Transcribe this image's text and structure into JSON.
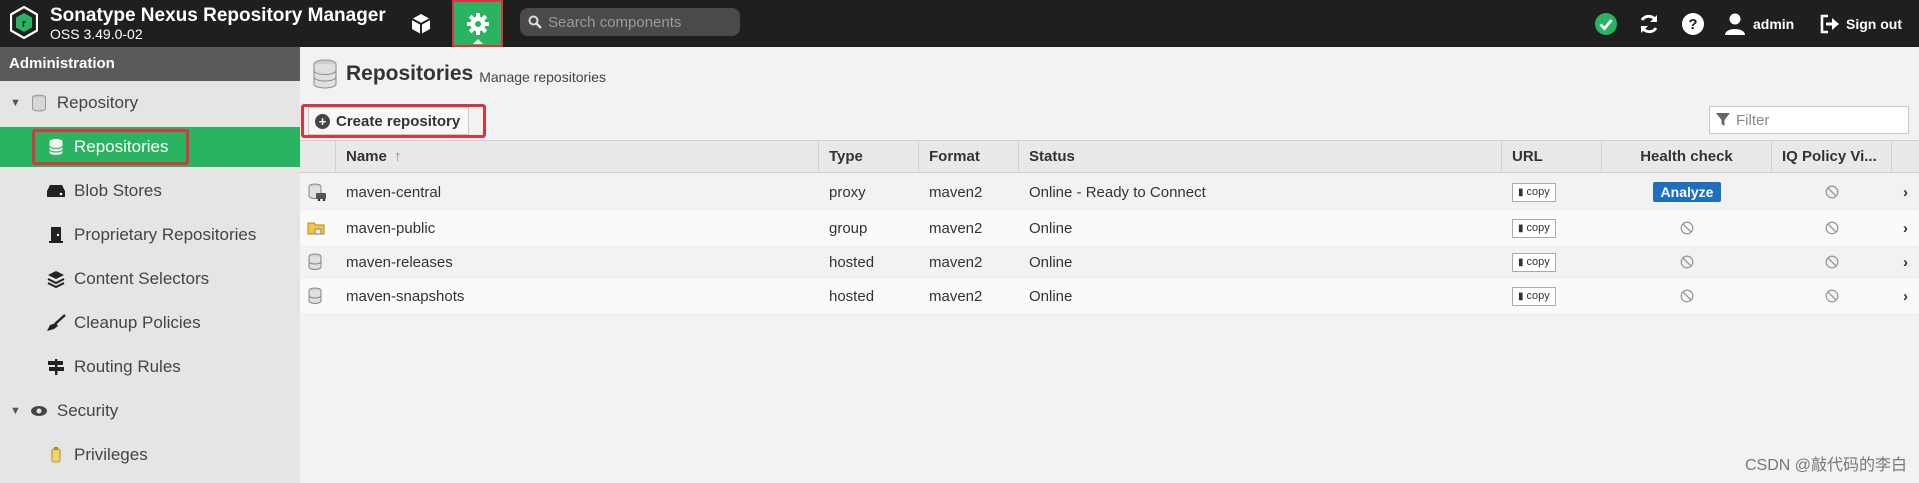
{
  "header": {
    "title": "Sonatype Nexus Repository Manager",
    "version": "OSS 3.49.0-02",
    "search_placeholder": "Search components",
    "user": "admin",
    "signout_label": "Sign out"
  },
  "sidebar": {
    "heading": "Administration",
    "items": [
      {
        "label": "Repository"
      },
      {
        "label": "Repositories"
      },
      {
        "label": "Blob Stores"
      },
      {
        "label": "Proprietary Repositories"
      },
      {
        "label": "Content Selectors"
      },
      {
        "label": "Cleanup Policies"
      },
      {
        "label": "Routing Rules"
      },
      {
        "label": "Security"
      },
      {
        "label": "Privileges"
      }
    ]
  },
  "main": {
    "title": "Repositories",
    "subtitle": "Manage repositories",
    "create_label": "Create repository",
    "filter_placeholder": "Filter",
    "columns": {
      "name": "Name",
      "sort_arrow": "↑",
      "type": "Type",
      "format": "Format",
      "status": "Status",
      "url": "URL",
      "health": "Health check",
      "iq": "IQ Policy Vi..."
    },
    "copy_label": "copy",
    "analyze_label": "Analyze",
    "rows": [
      {
        "name": "maven-central",
        "type": "proxy",
        "format": "maven2",
        "status": "Online - Ready to Connect"
      },
      {
        "name": "maven-public",
        "type": "group",
        "format": "maven2",
        "status": "Online"
      },
      {
        "name": "maven-releases",
        "type": "hosted",
        "format": "maven2",
        "status": "Online"
      },
      {
        "name": "maven-snapshots",
        "type": "hosted",
        "format": "maven2",
        "status": "Online"
      }
    ]
  },
  "watermark": "CSDN @敲代码的李白",
  "colors": {
    "accent": "#2ab462",
    "highlight": "#d9343f",
    "analyze": "#1e6fbf"
  }
}
